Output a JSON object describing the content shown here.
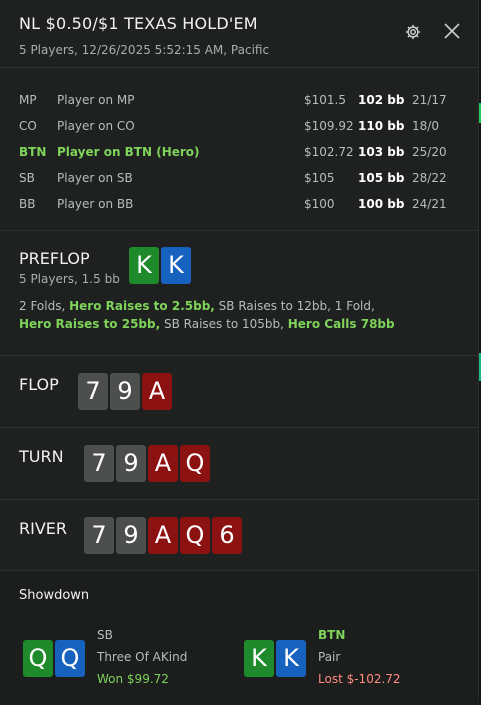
{
  "header": {
    "title": "NL $0.50/$1 TEXAS HOLD'EM",
    "subtitle": "5 Players, 12/26/2025 5:52:15 AM, Pacific"
  },
  "players": [
    {
      "pos": "MP",
      "name": "Player on MP",
      "money": "$101.5",
      "bb": "102 bb",
      "hands": "21/17",
      "hero": false
    },
    {
      "pos": "CO",
      "name": "Player on CO",
      "money": "$109.92",
      "bb": "110 bb",
      "hands": "18/0",
      "hero": false
    },
    {
      "pos": "BTN",
      "name": "Player on BTN (Hero)",
      "money": "$102.72",
      "bb": "103 bb",
      "hands": "25/20",
      "hero": true
    },
    {
      "pos": "SB",
      "name": "Player on SB",
      "money": "$105",
      "bb": "105 bb",
      "hands": "28/22",
      "hero": false
    },
    {
      "pos": "BB",
      "name": "Player on BB",
      "money": "$100",
      "bb": "100 bb",
      "hands": "24/21",
      "hero": false
    }
  ],
  "preflop": {
    "label": "PREFLOP",
    "sub": "5 Players, 1.5 bb",
    "hero_cards": [
      "K",
      "K"
    ],
    "actions": [
      {
        "text": "2 Folds, ",
        "hl": false
      },
      {
        "text": "Hero Raises to 2.5bb,",
        "hl": true
      },
      {
        "text": " SB Raises to 12bb, 1 Fold, ",
        "hl": false
      },
      {
        "text": "Hero Raises to 25bb,",
        "hl": true
      },
      {
        "text": " SB Raises to 105bb, ",
        "hl": false
      },
      {
        "text": "Hero Calls 78bb",
        "hl": true
      }
    ]
  },
  "flop": {
    "label": "FLOP",
    "cards": [
      "7",
      "9",
      "A"
    ]
  },
  "turn": {
    "label": "TURN",
    "cards": [
      "7",
      "9",
      "A",
      "Q"
    ]
  },
  "river": {
    "label": "RIVER",
    "cards": [
      "7",
      "9",
      "A",
      "Q",
      "6"
    ]
  },
  "showdown": {
    "title": "Showdown",
    "players": [
      {
        "pos": "SB",
        "hand": "Three Of AKind",
        "result": "Won $99.72",
        "cards": [
          "Q",
          "Q"
        ]
      },
      {
        "pos": "BTN",
        "hand": "Pair",
        "result": "Lost $-102.72",
        "cards": [
          "K",
          "K"
        ]
      }
    ]
  },
  "colors": {
    "accent_green": "#7fd35a",
    "lost_red": "#ff8a80",
    "card_green": "#1e8a2b",
    "card_blue": "#1762bf",
    "card_grey": "#4c4f4e",
    "card_red": "#8c1111"
  },
  "icons": {
    "settings": "gear-icon",
    "close": "close-icon"
  }
}
